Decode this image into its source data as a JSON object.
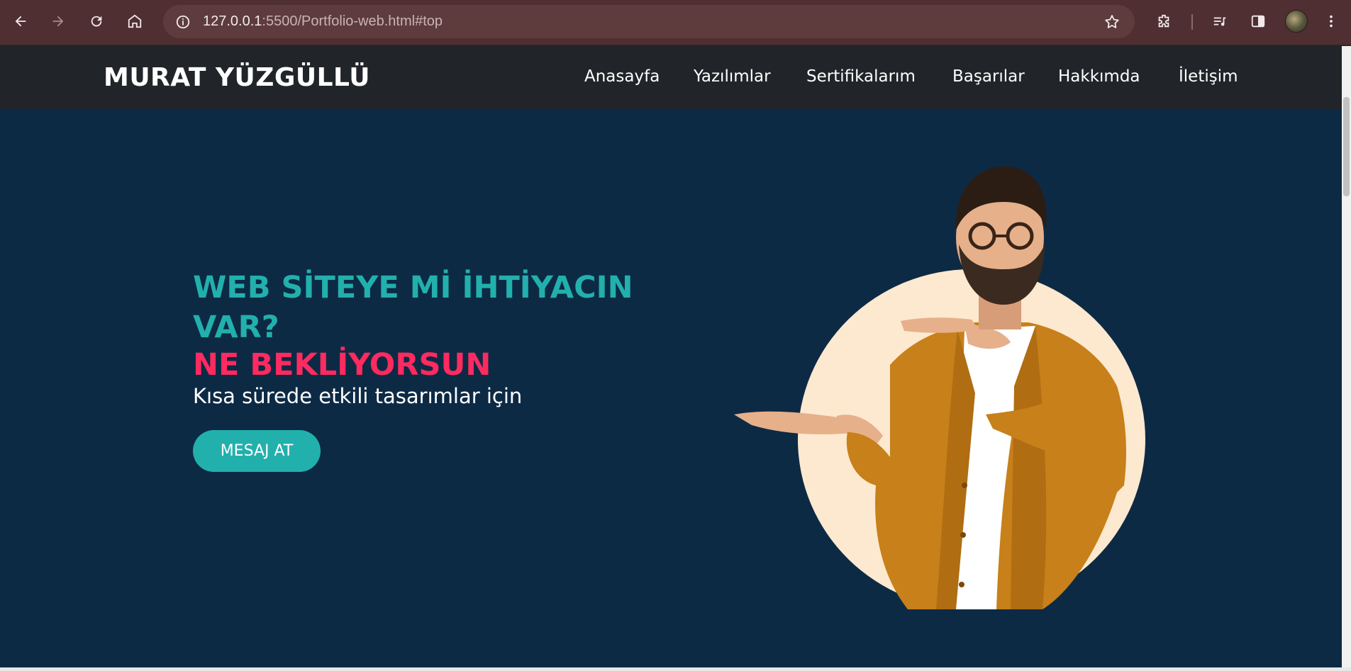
{
  "browser": {
    "url_host": "127.0.0.1",
    "url_rest": ":5500/Portfolio-web.html#top",
    "icons": [
      "back-arrow-icon",
      "forward-arrow-icon",
      "reload-icon",
      "home-icon",
      "site-info-icon",
      "bookmark-star-icon",
      "extensions-icon",
      "media-queue-icon",
      "side-panel-icon",
      "profile-avatar",
      "menu-dots-icon"
    ]
  },
  "navbar": {
    "brand": "MURAT YÜZGÜLLÜ",
    "items": [
      "Anasayfa",
      "Yazılımlar",
      "Sertifikalarım",
      "Başarılar",
      "Hakkımda",
      "İletişim"
    ]
  },
  "hero": {
    "headline": "WEB SİTEYE Mİ İHTİYACIN VAR?",
    "headline2": "NE BEKLİYORSUN",
    "subtitle": "Kısa sürede etkili tasarımlar için",
    "cta": "MESAJ AT"
  },
  "colors": {
    "chrome": "#4f2f31",
    "navbar": "#212529",
    "hero_bg": "#0d2a45",
    "teal": "#22b0ad",
    "pink": "#ff2a5f",
    "circle": "#fde9cf"
  }
}
